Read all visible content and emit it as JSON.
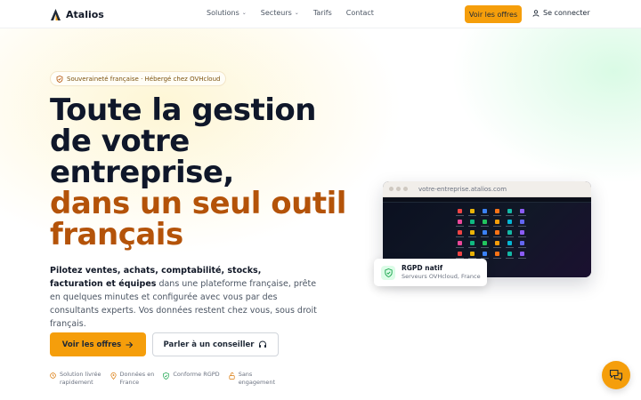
{
  "header": {
    "brand": "Atalios",
    "nav": [
      {
        "label": "Solutions",
        "dropdown": true
      },
      {
        "label": "Secteurs",
        "dropdown": true
      },
      {
        "label": "Tarifs",
        "dropdown": false
      },
      {
        "label": "Contact",
        "dropdown": false
      }
    ],
    "cta_label": "Voir les offres",
    "login_label": "Se connecter"
  },
  "hero": {
    "badge": "Souveraineté française · Hébergé chez OVHcloud",
    "headline_lines": [
      "Toute la gestion",
      "de votre",
      "entreprise,"
    ],
    "headline_accent_lines": [
      "dans un seul outil",
      "français"
    ],
    "subtext_bold": "Pilotez ventes, achats, comptabilité, stocks, facturation et équipes",
    "subtext_rest": " dans une plateforme française, prête en quelques minutes et configurée avec vous par des consultants experts. Vos données restent chez vous, sous droit français.",
    "primary_cta": "Voir les offres",
    "secondary_cta": "Parler à un conseiller",
    "features": [
      {
        "line1": "Solution livrée",
        "line2": "rapidement",
        "icon": "clock-icon"
      },
      {
        "line1": "Données en",
        "line2": "France",
        "icon": "map-pin-icon"
      },
      {
        "line1": "Conforme RGPD",
        "line2": "",
        "icon": "shield-check-icon"
      },
      {
        "line1": "Sans",
        "line2": "engagement",
        "icon": "unlock-icon"
      }
    ]
  },
  "mockup": {
    "url": "votre-entreprise.atalios.com",
    "card_title": "RGPD natif",
    "card_subtitle": "Serveurs OVHcloud, France"
  },
  "colors": {
    "accent": "#f59e0b",
    "accent_text": "#b45309",
    "heading": "#0f172a",
    "success": "#16a34a"
  }
}
